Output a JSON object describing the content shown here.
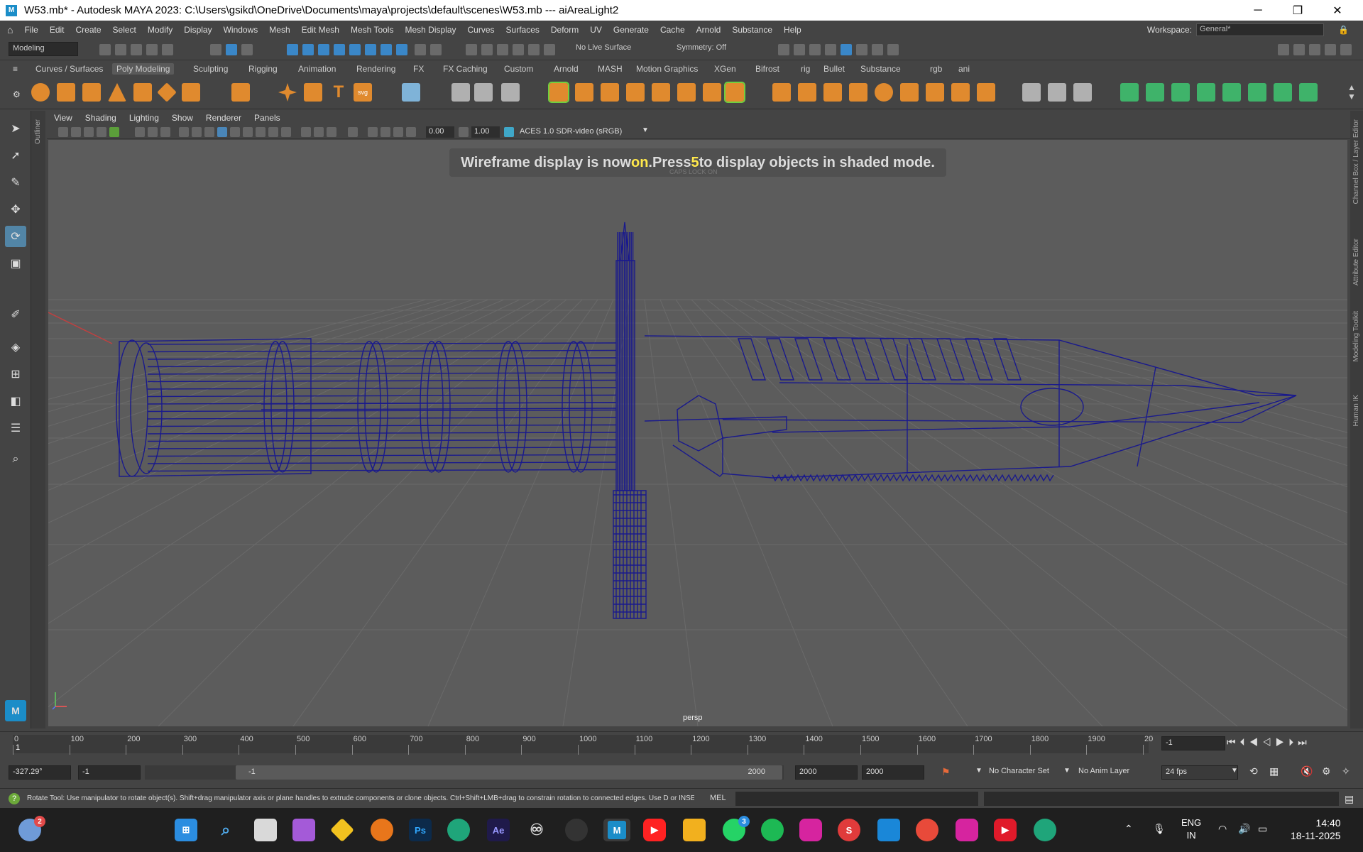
{
  "window": {
    "title": "W53.mb* - Autodesk MAYA 2023: C:\\Users\\gsikd\\OneDrive\\Documents\\maya\\projects\\default\\scenes\\W53.mb   ---   aiAreaLight2",
    "app_icon": "maya-logo-icon",
    "minimize": "─",
    "maximize": "❐",
    "close": "✕"
  },
  "menubar": {
    "items": [
      "File",
      "Edit",
      "Create",
      "Select",
      "Modify",
      "Display",
      "Windows",
      "Mesh",
      "Edit Mesh",
      "Mesh Tools",
      "Mesh Display",
      "Curves",
      "Surfaces",
      "Deform",
      "UV",
      "Generate",
      "Cache",
      "Arnold",
      "Substance",
      "Help"
    ],
    "workspace_label": "Workspace:",
    "workspace_value": "General*"
  },
  "statusline": {
    "menuset": "Modeling",
    "live_surface": "No Live Surface",
    "symmetry": "Symmetry: Off"
  },
  "shelf": {
    "tabs": [
      "Curves / Surfaces",
      "Poly Modeling",
      "Sculpting",
      "Rigging",
      "Animation",
      "Rendering",
      "FX",
      "FX Caching",
      "Custom",
      "Arnold",
      "MASH",
      "Motion Graphics",
      "XGen",
      "Bifrost",
      "rig",
      "Bullet",
      "Substance",
      "rgb",
      "ani"
    ],
    "active_tab": "Poly Modeling",
    "text_tool": "T",
    "svg_tool": "svg"
  },
  "panel": {
    "menus": [
      "View",
      "Shading",
      "Lighting",
      "Show",
      "Renderer",
      "Panels"
    ],
    "exposure": "0.00",
    "gamma": "1.00",
    "color_space": "ACES 1.0 SDR-video (sRGB)"
  },
  "viewport": {
    "hud_a": "Wireframe display is now ",
    "hud_on": "on",
    "hud_b": ".Press ",
    "hud_key": "5",
    "hud_c": " to display objects in shaded mode.",
    "caps": "CAPS LOCK ON",
    "camera": "persp",
    "wire_color": "#1a1a8c",
    "bg_color": "#5c5c5c"
  },
  "side_labels": {
    "outliner": "Outliner",
    "right": [
      "Channel Box / Layer Editor",
      "Attribute Editor",
      "Modeling Toolkit",
      "Human IK"
    ]
  },
  "timeline": {
    "ticks": [
      "0",
      "100",
      "200",
      "300",
      "400",
      "500",
      "600",
      "700",
      "800",
      "900",
      "1000",
      "1100",
      "1200",
      "1300",
      "1400",
      "1500",
      "1600",
      "1700",
      "1800",
      "1900",
      "20"
    ],
    "current_frame_marker": "1",
    "current_frame": "-1"
  },
  "range": {
    "rotation_readout": "-327.29°",
    "start": "-1",
    "slider_start": "-1",
    "slider_end": "2000",
    "end": "2000",
    "end2": "2000",
    "char_set": "No Character Set",
    "anim_layer": "No Anim Layer",
    "fps": "24 fps"
  },
  "helpline": {
    "text": "Rotate Tool: Use manipulator to rotate object(s). Shift+drag manipulator axis or plane handles to extrude components or clone objects. Ctrl+Shift+LMB+drag to constrain rotation to connected edges. Use D or INSE",
    "mel": "MEL"
  },
  "taskbar": {
    "weather_badge": "2",
    "ps": "Ps",
    "ae": "Ae",
    "whatsapp_badge": "3",
    "lang1": "ENG",
    "lang2": "IN",
    "time": "14:40",
    "date": "18-11-2025",
    "maya": "M"
  }
}
